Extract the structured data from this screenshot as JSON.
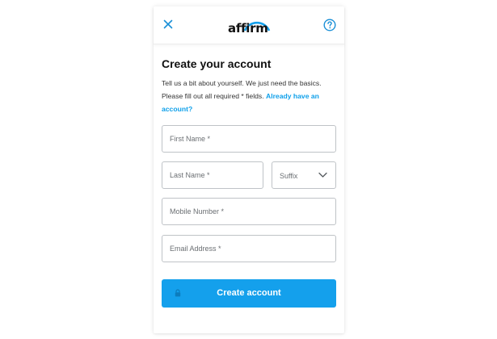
{
  "header": {
    "logo_text": "affirm",
    "close_icon": "close-icon",
    "help_icon": "help-icon"
  },
  "form": {
    "title": "Create your account",
    "description": "Tell us a bit about yourself. We just need the basics. Please fill out all required * fields.",
    "signin_link": "Already have an account?",
    "first_name": {
      "placeholder": "First Name *",
      "value": ""
    },
    "last_name": {
      "placeholder": "Last Name *",
      "value": ""
    },
    "suffix": {
      "selected": "Suffix"
    },
    "mobile": {
      "placeholder": "Mobile Number *",
      "value": ""
    },
    "email": {
      "placeholder": "Email Address *",
      "value": ""
    },
    "submit_label": "Create account",
    "submit_icon": "lock-icon"
  },
  "colors": {
    "accent": "#14a0ec",
    "link": "#0fa0ea",
    "icon": "#1a8fd6",
    "text": "#111111"
  }
}
